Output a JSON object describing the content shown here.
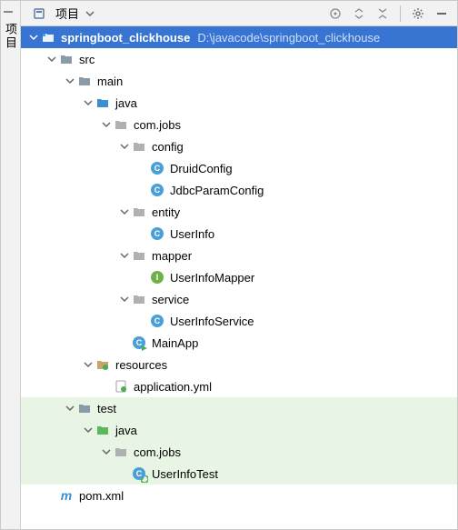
{
  "toolbar": {
    "title_label": "项目",
    "sidetab_label": "项目"
  },
  "tree": {
    "root": {
      "name": "springboot_clickhouse",
      "path": "D:\\javacode\\springboot_clickhouse"
    },
    "src": "src",
    "main": "main",
    "java_main": "java",
    "pkg_main": "com.jobs",
    "config": "config",
    "druid": "DruidConfig",
    "jdbcparam": "JdbcParamConfig",
    "entity": "entity",
    "userinfo": "UserInfo",
    "mapper": "mapper",
    "userinfomapper": "UserInfoMapper",
    "service": "service",
    "userinfoservice": "UserInfoService",
    "mainapp": "MainApp",
    "resources": "resources",
    "appyml": "application.yml",
    "test": "test",
    "java_test": "java",
    "pkg_test": "com.jobs",
    "userinfotest": "UserInfoTest",
    "pom": "pom.xml"
  }
}
